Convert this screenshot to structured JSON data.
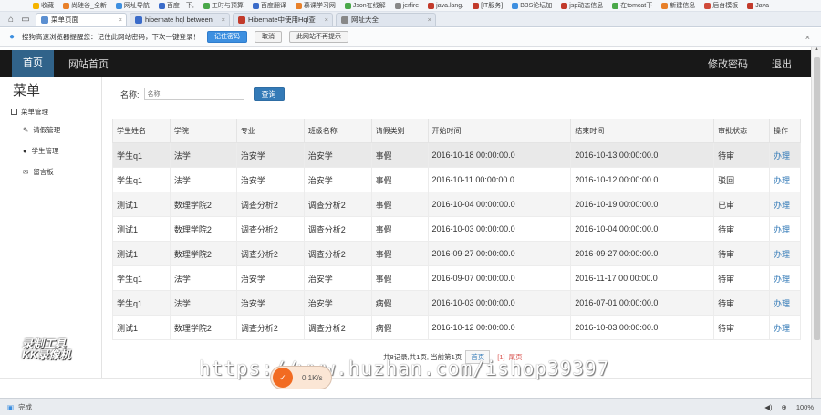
{
  "browser": {
    "bookmarks": [
      "收藏",
      "尚硅谷_全新",
      "网址导航",
      "百度一下,",
      "工时与预算",
      "百度翻译",
      "慕课学习网",
      "Json在线解",
      "jerfire",
      "java.lang.",
      "[IT服务]",
      "BBS论坛加",
      "jsp动态信息",
      "在tomcat下",
      "新建信息",
      "后台模板",
      "Java"
    ],
    "tabs": [
      "菜单页面",
      "hibernate hql between",
      "Hibernate中使用Hql查",
      "网址大全"
    ],
    "notify": {
      "text": "搜狗高速浏览器提醒您：记住此网站密码，下次一键登录！",
      "save": "记住密码",
      "cancel": "取消",
      "never": "此网站不再提示"
    },
    "status_left": "完成",
    "zoom": "100%"
  },
  "topbar": {
    "home": "首页",
    "site_home": "网站首页",
    "change_password": "修改密码",
    "logout": "退出"
  },
  "sidebar": {
    "title": "菜单",
    "group": "菜单管理",
    "items": [
      "请假管理",
      "学生管理",
      "留言板"
    ]
  },
  "search": {
    "label": "名称:",
    "placeholder": "名称",
    "button": "查询"
  },
  "table": {
    "headers": [
      "学生姓名",
      "学院",
      "专业",
      "班级名称",
      "请假类别",
      "开始时间",
      "结束时间",
      "审批状态",
      "操作"
    ],
    "rows": [
      [
        "学生q1",
        "法学",
        "治安学",
        "治安学",
        "事假",
        "2016-10-18 00:00:00.0",
        "2016-10-13 00:00:00.0",
        "待审",
        "办理"
      ],
      [
        "学生q1",
        "法学",
        "治安学",
        "治安学",
        "事假",
        "2016-10-11 00:00:00.0",
        "2016-10-12 00:00:00.0",
        "驳回",
        "办理"
      ],
      [
        "测试1",
        "数理学院2",
        "调查分析2",
        "调查分析2",
        "事假",
        "2016-10-04 00:00:00.0",
        "2016-10-19 00:00:00.0",
        "已审",
        "办理"
      ],
      [
        "测试1",
        "数理学院2",
        "调查分析2",
        "调查分析2",
        "事假",
        "2016-10-03 00:00:00.0",
        "2016-10-04 00:00:00.0",
        "待审",
        "办理"
      ],
      [
        "测试1",
        "数理学院2",
        "调查分析2",
        "调查分析2",
        "事假",
        "2016-09-27 00:00:00.0",
        "2016-09-27 00:00:00.0",
        "待审",
        "办理"
      ],
      [
        "学生q1",
        "法学",
        "治安学",
        "治安学",
        "事假",
        "2016-09-07 00:00:00.0",
        "2016-11-17 00:00:00.0",
        "待审",
        "办理"
      ],
      [
        "学生q1",
        "法学",
        "治安学",
        "治安学",
        "病假",
        "2016-10-03 00:00:00.0",
        "2016-07-01 00:00:00.0",
        "待审",
        "办理"
      ],
      [
        "测试1",
        "数理学院2",
        "调查分析2",
        "调查分析2",
        "病假",
        "2016-10-12 00:00:00.0",
        "2016-10-03 00:00:00.0",
        "待审",
        "办理"
      ]
    ]
  },
  "pager": {
    "summary": "共8记录,共1页, 当前第1页",
    "first": "首页",
    "current": "[1]",
    "last": "尾页"
  },
  "watermark": {
    "recorder": "录制工具\nKK录像机",
    "url": "https://www.huzhan.com/ishop39397",
    "badge": "0.1K/s"
  }
}
